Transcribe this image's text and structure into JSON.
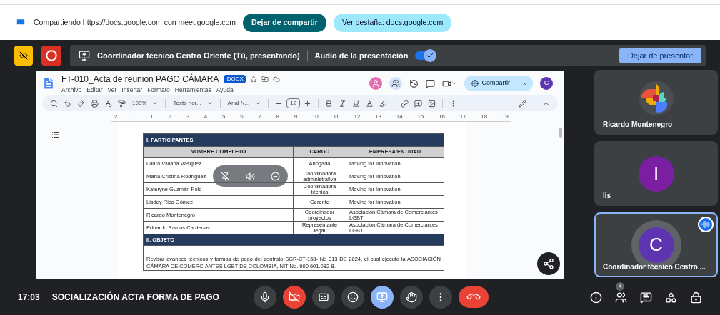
{
  "share_bar": {
    "message": "Compartiendo https://docs.google.com con meet.google.com",
    "stop_button": "Dejar de compartir",
    "view_button": "Ver pestaña: docs.google.com"
  },
  "present_bar": {
    "title": "Coordinador técnico Centro Oriente (Tú, presentando)",
    "audio_label": "Audio de la presentación",
    "audio_on": true,
    "stop_button": "Dejar de presentar"
  },
  "doc": {
    "title": "FT-010_Acta de reunión PAGO CÁMARA",
    "badge": ".DOCX",
    "menu": [
      "Archivo",
      "Editar",
      "Ver",
      "Insertar",
      "Formato",
      "Herramientas",
      "Ayuda"
    ],
    "share_button": "Compartir",
    "user_initial": "C",
    "toolbar": {
      "zoom": "100%",
      "style": "Texto nor...",
      "font": "Arial N...",
      "size": "12"
    },
    "ruler": [
      "2",
      "1",
      "1",
      "2",
      "3",
      "4",
      "5",
      "6",
      "7",
      "8",
      "9",
      "10",
      "11",
      "12",
      "13",
      "14",
      "15",
      "16",
      "17",
      "18",
      "19"
    ],
    "section_1": "I. PARTICIPANTES",
    "columns": [
      "NOMBRE COMPLETO",
      "CARGO",
      "EMPRESA/ENTIDAD"
    ],
    "rows": [
      [
        "Laura Viviana Vásquez",
        "Abogada",
        "Moving for Innovation"
      ],
      [
        "María Cristina Rodríguez",
        "Coordinadora administrativa",
        "Moving for Innovation"
      ],
      [
        "Kateryne Guzmán Polo",
        "Coordinadora técnica",
        "Moving for Innovation"
      ],
      [
        "Lisdey Rico Gómez",
        "Gerente",
        "Moving for Innovation"
      ],
      [
        "Ricardo Montenegro",
        "Coordinador proyectos",
        "Asociación Cámara de Comerciantes LGBT"
      ],
      [
        "Eduardo Ramos Cardenas",
        "Representante legal",
        "Asociación Cámara de Comerciantes LGBT"
      ]
    ],
    "section_2": "II. OBJETO",
    "paragraph": "Revisar avances técnicos y formas de pago del contrato SGR-CT-158- No 013 DE 2024, el cual ejecuta la ASOCIACIÓN CÁMARA DE COMERCIANTES LGBT DE COLOMBIA, NIT No. 900.601.082-8."
  },
  "participants": [
    {
      "name": "Ricardo Montenegro",
      "kind": "logo",
      "speaking": false
    },
    {
      "name": "lis",
      "kind": "letter",
      "initial": "I",
      "color": "#7b1fa2",
      "speaking": false
    },
    {
      "name": "Coordinador técnico Centro ...",
      "kind": "letter",
      "initial": "C",
      "color": "#5e35b1",
      "speaking": true
    }
  ],
  "meeting": {
    "time": "17:03",
    "title": "SOCIALIZACIÓN ACTA FORMA DE PAGO",
    "camera_on": false,
    "presenting": true,
    "people_count": "4"
  }
}
